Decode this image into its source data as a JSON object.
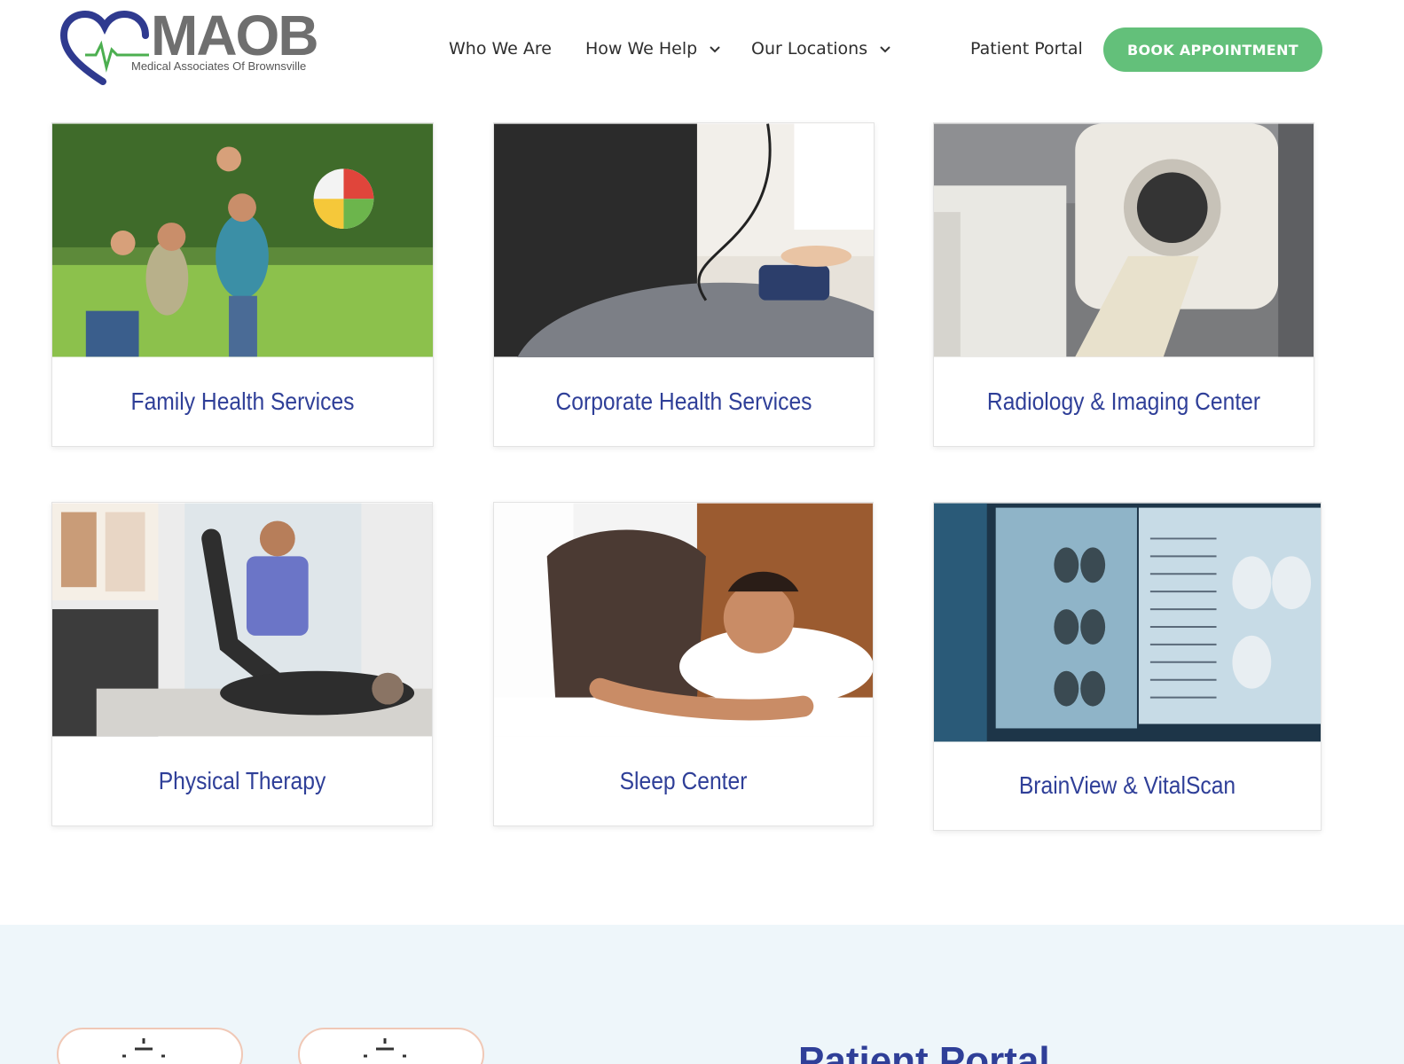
{
  "brand": {
    "name": "MAOB",
    "tagline": "Medical Associates Of Brownsville",
    "primary_color": "#2f3f98",
    "accent_color": "#63c07a"
  },
  "nav": {
    "who_we_are": "Who We Are",
    "how_we_help": "How We Help",
    "our_locations": "Our Locations",
    "patient_portal": "Patient Portal",
    "book_appointment": "BOOK APPOINTMENT"
  },
  "services": [
    {
      "title": "Family Health Services",
      "image": "family-outdoors-photo"
    },
    {
      "title": "Corporate Health Services",
      "image": "blood-pressure-check-photo"
    },
    {
      "title": "Radiology & Imaging Center",
      "image": "ct-scanner-photo"
    },
    {
      "title": "Physical Therapy",
      "image": "therapist-stretching-patient-photo"
    },
    {
      "title": "Sleep Center",
      "image": "man-sleeping-photo"
    },
    {
      "title": "BrainView & VitalScan",
      "image": "brain-scan-monitors-photo"
    }
  ],
  "portal_section": {
    "heading": "Patient Portal"
  }
}
